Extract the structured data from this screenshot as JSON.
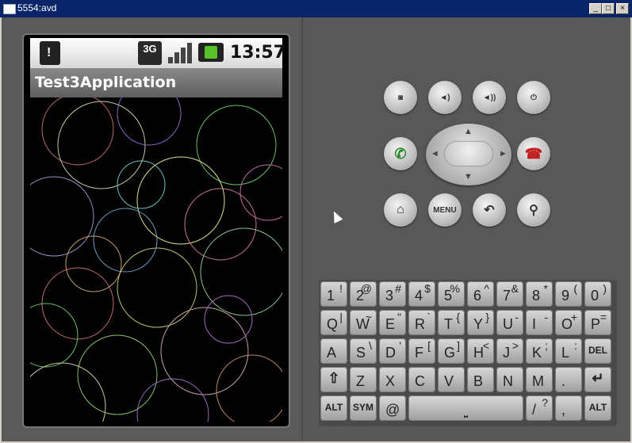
{
  "window": {
    "title": "5554:avd"
  },
  "status_bar": {
    "network": "3G",
    "time": "13:57"
  },
  "app": {
    "title": "Test3Application"
  },
  "controls": {
    "row1": [
      "camera-icon",
      "volume-down-icon",
      "volume-up-icon",
      "power-icon"
    ],
    "row2": [
      "call-icon",
      "dpad",
      "end-call-icon"
    ],
    "row3": [
      "home-icon",
      "MENU",
      "back-icon",
      "search-icon"
    ]
  },
  "keyboard": {
    "row1": [
      [
        "1",
        "!"
      ],
      [
        "2",
        "@"
      ],
      [
        "3",
        "#"
      ],
      [
        "4",
        "$"
      ],
      [
        "5",
        "%"
      ],
      [
        "6",
        "^"
      ],
      [
        "7",
        "&"
      ],
      [
        "8",
        "*"
      ],
      [
        "9",
        "("
      ],
      [
        "0",
        ")"
      ]
    ],
    "row2": [
      [
        "Q",
        "|"
      ],
      [
        "W",
        "~"
      ],
      [
        "E",
        "\""
      ],
      [
        "R",
        "`"
      ],
      [
        "T",
        "{"
      ],
      [
        "Y",
        "}"
      ],
      [
        "U",
        "-"
      ],
      [
        "I",
        "-"
      ],
      [
        "O",
        "+"
      ],
      [
        "P",
        "="
      ]
    ],
    "row3": [
      [
        "A",
        ""
      ],
      [
        "S",
        "\\"
      ],
      [
        "D",
        "'"
      ],
      [
        "F",
        "["
      ],
      [
        "G",
        "]"
      ],
      [
        "H",
        "<"
      ],
      [
        "J",
        ">"
      ],
      [
        "K",
        ";"
      ],
      [
        "L",
        ":"
      ],
      [
        "DEL",
        ""
      ]
    ],
    "row4": [
      "Z",
      "X",
      "C",
      "V",
      "B",
      "N",
      "M",
      "."
    ],
    "row5": [
      "ALT",
      "SYM",
      "@",
      "/",
      "?",
      ",",
      "ALT"
    ]
  }
}
